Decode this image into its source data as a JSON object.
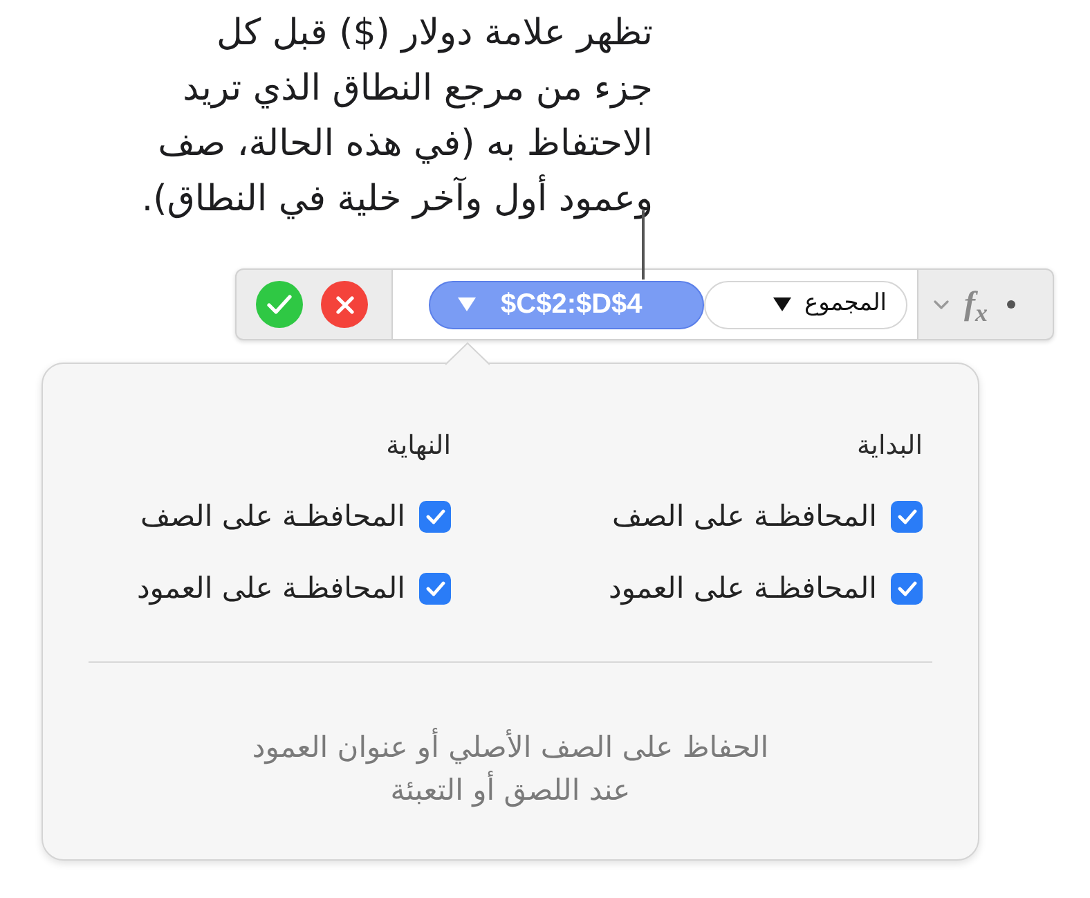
{
  "callout": {
    "text": "تظهر علامة دولار ($) قبل كل\nجزء من مرجع النطاق الذي تريد\nالاحتفاظ به (في هذه الحالة، صف\nوعمود أول وآخر خلية في النطاق)."
  },
  "formula_bar": {
    "range_token": {
      "label": "$C$2:$D$4",
      "selected": true
    },
    "function_token": {
      "label": "المجموع"
    },
    "function_button": {
      "label": "f$_{x}$"
    }
  },
  "popover": {
    "sections": [
      {
        "title": "البداية",
        "options": [
          {
            "label": "المحافظـة على الصف",
            "checked": true
          },
          {
            "label": "المحافظـة على العمود",
            "checked": true
          }
        ]
      },
      {
        "title": "النهاية",
        "options": [
          {
            "label": "المحافظـة على الصف",
            "checked": true
          },
          {
            "label": "المحافظـة على العمود",
            "checked": true
          }
        ]
      }
    ],
    "footer": "الحفاظ على الصف الأصلي أو عنوان العمود\nعند اللصق أو التعبئة"
  }
}
